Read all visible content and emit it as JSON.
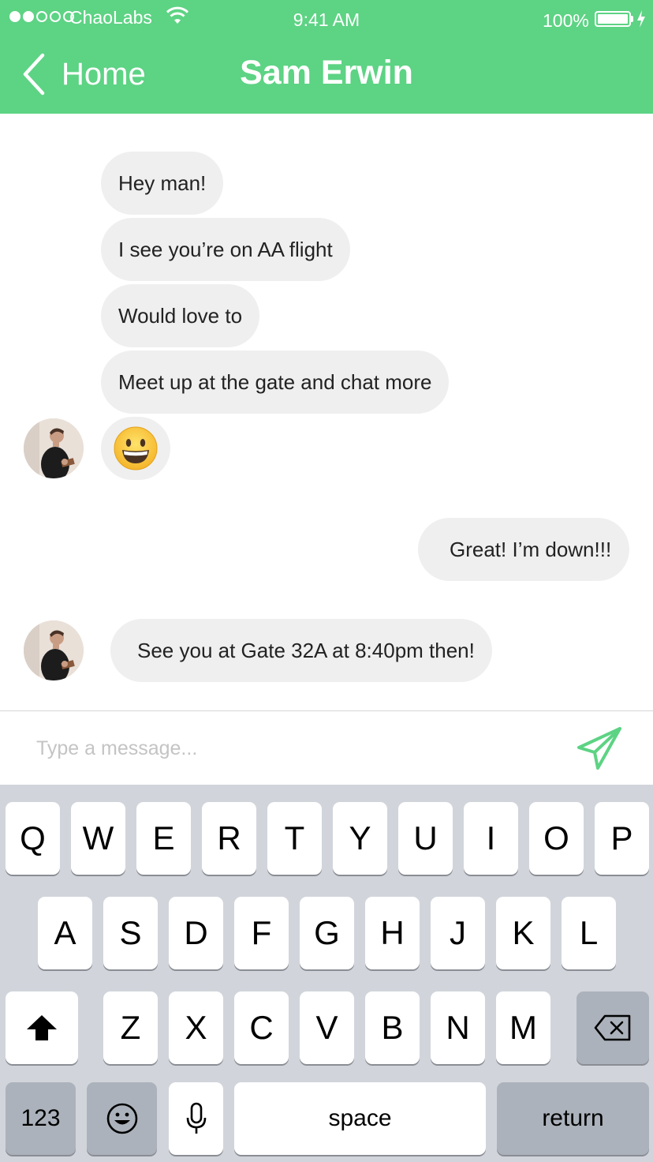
{
  "status_bar": {
    "carrier": "ChaoLabs",
    "time": "9:41 AM",
    "battery": "100%",
    "signal_bars_filled": 2,
    "signal_bars_total": 5
  },
  "nav": {
    "back_label": "Home",
    "title": "Sam Erwin"
  },
  "messages": {
    "incoming_group_1": [
      "Hey man!",
      "I see you’re on AA flight",
      "Would love to",
      "Meet up at the gate and chat more"
    ],
    "incoming_emoji": "grinning-face-emoji",
    "outgoing": "Great! I’m down!!!",
    "incoming_2": "See you at Gate 32A at 8:40pm then!"
  },
  "composer": {
    "placeholder": "Type a message...",
    "send_icon": "send-paper-plane-icon"
  },
  "keyboard": {
    "row1": [
      "Q",
      "W",
      "E",
      "R",
      "T",
      "Y",
      "U",
      "I",
      "O",
      "P"
    ],
    "row2": [
      "A",
      "S",
      "D",
      "F",
      "G",
      "H",
      "J",
      "K",
      "L"
    ],
    "row3": [
      "Z",
      "X",
      "C",
      "V",
      "B",
      "N",
      "M"
    ],
    "numbers_label": "123",
    "space_label": "space",
    "return_label": "return"
  },
  "colors": {
    "accent": "#5dd384",
    "bubble": "#efefef",
    "keyboard_bg": "#d1d5db",
    "dark_key": "#abb2bb"
  }
}
